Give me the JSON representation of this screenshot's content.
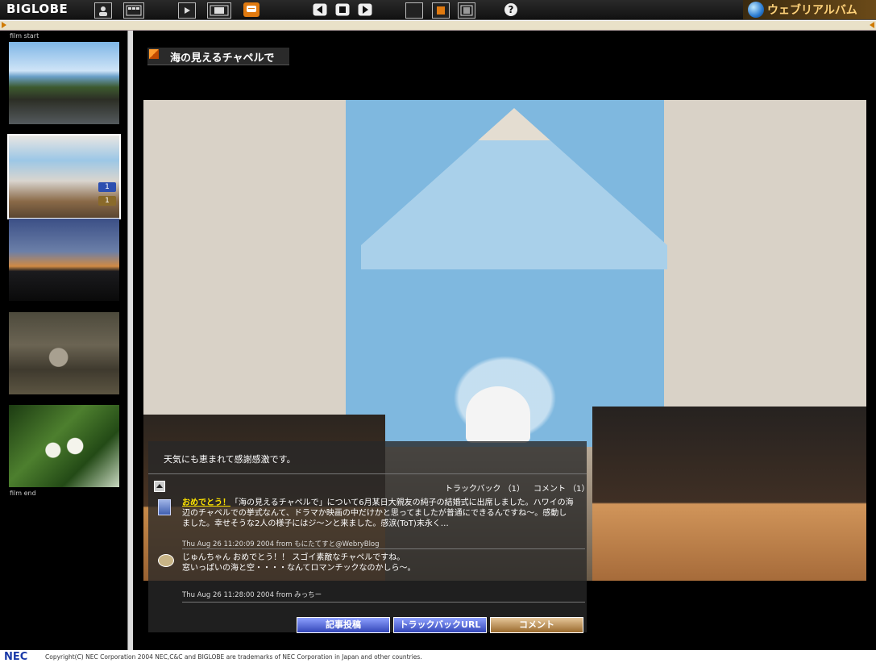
{
  "toolbar": {
    "logo": "BIGLOBE",
    "brand": "ウェブリアルバム",
    "help": "?"
  },
  "film": {
    "start_label": "film start",
    "end_label": "film end",
    "thumbnails": [
      {
        "badge": ""
      },
      {
        "badge_trackback": "1",
        "badge_comment": "1"
      },
      {
        "badge": ""
      },
      {
        "badge": ""
      },
      {
        "badge": ""
      }
    ]
  },
  "main": {
    "title": "海の見えるチャペルで",
    "caption": "天気にも恵まれて感謝感激です。",
    "trackback_count": "トラックバック （1）",
    "comment_count": "コメント （1）",
    "entries": [
      {
        "highlight": "おめでとう！",
        "text": "「海の見えるチャペルで」について6月某日大親友の純子の結婚式に出席しました。ハワイの海辺のチャペルでの挙式なんて、ドラマか映画の中だけかと思ってましたが普通にできるんですね～。感動しました。幸せそうな2人の様子にはジ～ンと来ました。感涙(ToT)末永く…",
        "meta": "Thu Aug 26 11:20:09 2004 from もにたてすと@WebryBlog"
      },
      {
        "text": "じゅんちゃん おめでとう！！ スゴイ素敵なチャペルですね。\n 窓いっぱいの海と空・・・・なんてロマンチックなのかしら～。",
        "meta": "Thu Aug 26 11:28:00 2004 from みっちー"
      }
    ],
    "buttons": {
      "post": "記事投稿",
      "trackback_url": "トラックバックURL",
      "comment": "コメント"
    }
  },
  "footer": {
    "logo": "NEC",
    "copyright": "Copyright(C) NEC Corporation 2004 NEC,C&C and BIGLOBE are trademarks of NEC Corporation in Japan and other countries."
  },
  "colors": {
    "accent_orange": "#d07a00",
    "highlight_yellow": "#ffe400",
    "button_blue": "#3447b8",
    "button_brown": "#9a6a2c"
  }
}
